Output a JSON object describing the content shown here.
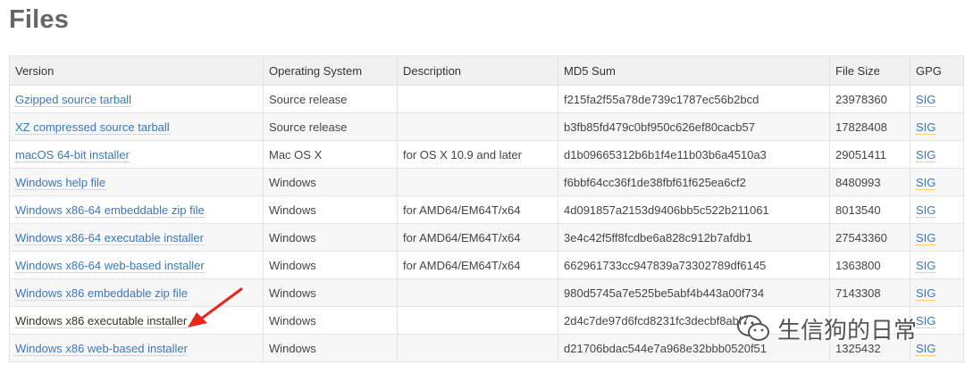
{
  "page": {
    "title": "Files"
  },
  "table": {
    "columns": [
      "Version",
      "Operating System",
      "Description",
      "MD5 Sum",
      "File Size",
      "GPG"
    ],
    "rows": [
      {
        "version": "Gzipped source tarball",
        "os": "Source release",
        "description": "",
        "md5": "f215fa2f55a78de739c1787ec56b2bcd",
        "size": "23978360",
        "gpg": "SIG"
      },
      {
        "version": "XZ compressed source tarball",
        "os": "Source release",
        "description": "",
        "md5": "b3fb85fd479c0bf950c626ef80cacb57",
        "size": "17828408",
        "gpg": "SIG"
      },
      {
        "version": "macOS 64-bit installer",
        "os": "Mac OS X",
        "description": "for OS X 10.9 and later",
        "md5": "d1b09665312b6b1f4e11b03b6a4510a3",
        "size": "29051411",
        "gpg": "SIG"
      },
      {
        "version": "Windows help file",
        "os": "Windows",
        "description": "",
        "md5": "f6bbf64cc36f1de38fbf61f625ea6cf2",
        "size": "8480993",
        "gpg": "SIG"
      },
      {
        "version": "Windows x86-64 embeddable zip file",
        "os": "Windows",
        "description": "for AMD64/EM64T/x64",
        "md5": "4d091857a2153d9406bb5c522b211061",
        "size": "8013540",
        "gpg": "SIG"
      },
      {
        "version": "Windows x86-64 executable installer",
        "os": "Windows",
        "description": "for AMD64/EM64T/x64",
        "md5": "3e4c42f5ff8fcdbe6a828c912b7afdb1",
        "size": "27543360",
        "gpg": "SIG"
      },
      {
        "version": "Windows x86-64 web-based installer",
        "os": "Windows",
        "description": "for AMD64/EM64T/x64",
        "md5": "662961733cc947839a73302789df6145",
        "size": "1363800",
        "gpg": "SIG"
      },
      {
        "version": "Windows x86 embeddable zip file",
        "os": "Windows",
        "description": "",
        "md5": "980d5745a7e525be5abf4b443a00f734",
        "size": "7143308",
        "gpg": "SIG"
      },
      {
        "version": "Windows x86 executable installer",
        "os": "Windows",
        "description": "",
        "md5": "2d4c7de97d6fcd8231fc3decbf8abf7",
        "size": "",
        "gpg": "SIG"
      },
      {
        "version": "Windows x86 web-based installer",
        "os": "Windows",
        "description": "",
        "md5": "d21706bdac544e7a968e32bbb0520f51",
        "size": "1325432",
        "gpg": "SIG"
      }
    ]
  },
  "watermark": {
    "text": "生信狗的日常",
    "icon": "wechat-icon"
  },
  "annotation": {
    "icon": "red-arrow-icon",
    "color": "#e8261c"
  },
  "colors": {
    "link": "#3b78b5",
    "link_underline": "#e9b55a"
  }
}
